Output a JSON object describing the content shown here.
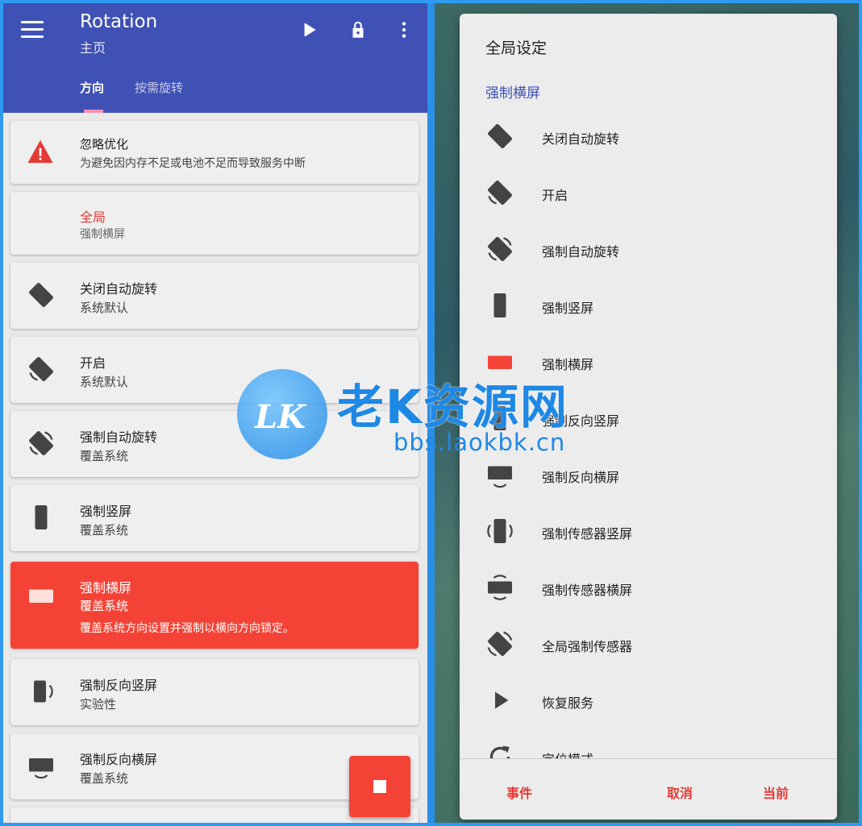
{
  "app": {
    "title": "Rotation",
    "subtitle": "主页",
    "tabs": [
      "方向",
      "按需旋转"
    ],
    "active_tab": "方向",
    "fab_icon": "stop-icon"
  },
  "cards": [
    {
      "title": "忽略优化",
      "subtitle": "为避免因内存不足或电池不足而导致服务中断",
      "icon": "warning-icon"
    },
    {
      "title": "全局",
      "subtitle": "强制横屏",
      "icon": ""
    },
    {
      "title": "关闭自动旋转",
      "subtitle": "系统默认",
      "icon": "rotation-off-icon"
    },
    {
      "title": "开启",
      "subtitle": "系统默认",
      "icon": "rotation-on-icon"
    },
    {
      "title": "强制自动旋转",
      "subtitle": "覆盖系统",
      "icon": "force-auto-rotate-icon"
    },
    {
      "title": "强制竖屏",
      "subtitle": "覆盖系统",
      "icon": "portrait-icon"
    },
    {
      "title": "强制横屏",
      "subtitle": "覆盖系统",
      "detail": "覆盖系统方向设置并强制以横向方向锁定。",
      "icon": "landscape-icon",
      "selected": true
    },
    {
      "title": "强制反向竖屏",
      "subtitle": "实验性",
      "icon": "reverse-portrait-icon"
    },
    {
      "title": "强制反向横屏",
      "subtitle": "覆盖系统",
      "icon": "reverse-landscape-icon"
    }
  ],
  "dialog": {
    "title": "全局设定",
    "current": "强制横屏",
    "options": [
      {
        "label": "关闭自动旋转",
        "icon": "rotation-off-icon"
      },
      {
        "label": "开启",
        "icon": "rotation-on-icon"
      },
      {
        "label": "强制自动旋转",
        "icon": "force-auto-rotate-icon"
      },
      {
        "label": "强制竖屏",
        "icon": "portrait-icon"
      },
      {
        "label": "强制横屏",
        "icon": "landscape-icon",
        "selected": true
      },
      {
        "label": "强制反向竖屏",
        "icon": "reverse-portrait-icon"
      },
      {
        "label": "强制反向横屏",
        "icon": "reverse-landscape-icon"
      },
      {
        "label": "强制传感器竖屏",
        "icon": "sensor-portrait-icon"
      },
      {
        "label": "强制传感器横屏",
        "icon": "sensor-landscape-icon"
      },
      {
        "label": "全局强制传感器",
        "icon": "full-sensor-icon"
      },
      {
        "label": "恢复服务",
        "icon": "play-icon"
      },
      {
        "label": "定位模式",
        "icon": "refresh-icon"
      }
    ],
    "buttons": {
      "events": "事件",
      "cancel": "取消",
      "current": "当前"
    }
  },
  "watermark": {
    "logo": "LK",
    "text": "老K资源网",
    "url": "bbs.laokbk.cn"
  },
  "colors": {
    "primary": "#3f51b5",
    "accent": "#f44336",
    "tab_indicator": "#f48fb1",
    "frame": "#2f9af0"
  }
}
